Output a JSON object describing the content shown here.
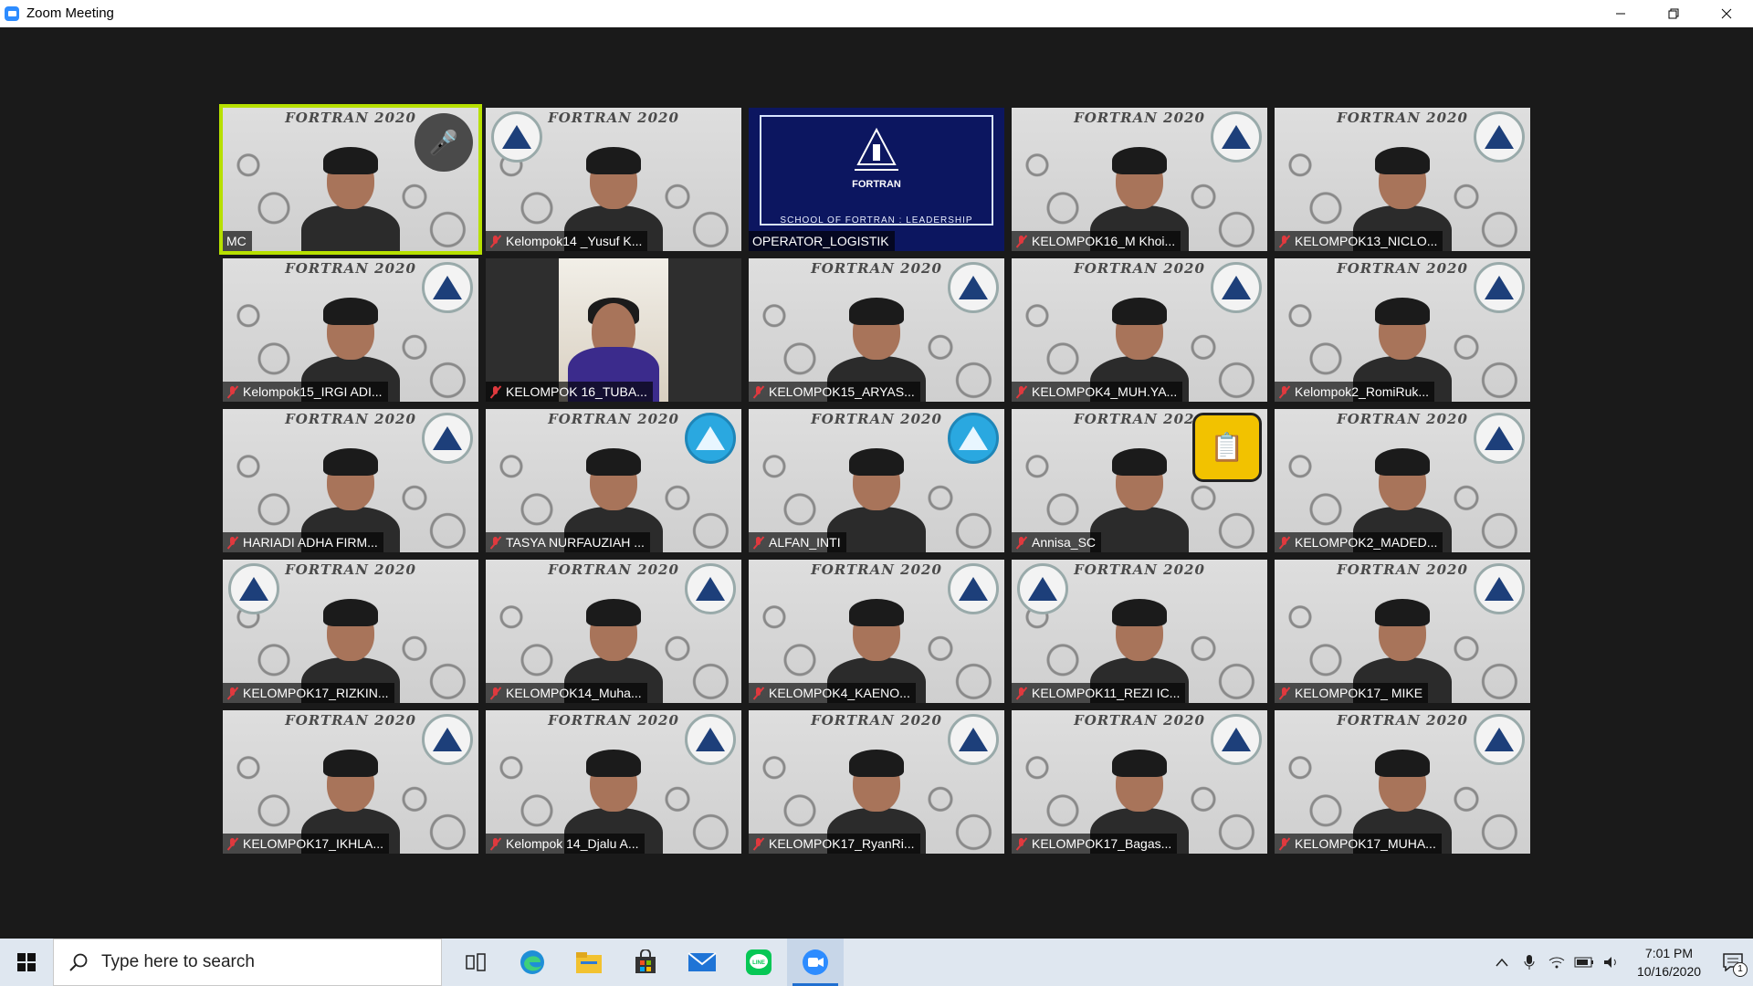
{
  "window": {
    "title": "Zoom Meeting"
  },
  "meeting": {
    "active_speaker": "MC",
    "tile_banner": "FORTRAN 2020",
    "operator_brand": "FORTRAN",
    "operator_tagline": "SCHOOL OF FORTRAN : LEADERSHIP",
    "participants": [
      {
        "name": "MC",
        "muted": false,
        "active": true,
        "badge": "mic-icon"
      },
      {
        "name": "Kelompok14 _Yusuf K...",
        "muted": true
      },
      {
        "name": "OPERATOR_LOGISTIK",
        "muted": false,
        "type": "slide"
      },
      {
        "name": "KELOMPOK16_M Khoi...",
        "muted": true
      },
      {
        "name": "KELOMPOK13_NICLO...",
        "muted": true
      },
      {
        "name": "Kelompok15_IRGI ADI...",
        "muted": true
      },
      {
        "name": "KELOMPOK 16_TUBA...",
        "muted": true,
        "type": "selfie"
      },
      {
        "name": "KELOMPOK15_ARYAS...",
        "muted": true
      },
      {
        "name": "KELOMPOK4_MUH.YA...",
        "muted": true
      },
      {
        "name": "Kelompok2_RomiRuk...",
        "muted": true
      },
      {
        "name": "HARIADI ADHA FIRM...",
        "muted": true
      },
      {
        "name": "TASYA NURFAUZIAH ...",
        "muted": true
      },
      {
        "name": "ALFAN_INTI",
        "muted": true
      },
      {
        "name": "Annisa_SC",
        "muted": true,
        "badge": "clipboard-icon"
      },
      {
        "name": "KELOMPOK2_MADED...",
        "muted": true
      },
      {
        "name": "KELOMPOK17_RIZKIN...",
        "muted": true
      },
      {
        "name": "KELOMPOK14_Muha...",
        "muted": true
      },
      {
        "name": "KELOMPOK4_KAENO...",
        "muted": true
      },
      {
        "name": "KELOMPOK11_REZI IC...",
        "muted": true
      },
      {
        "name": "KELOMPOK17_ MIKE",
        "muted": true
      },
      {
        "name": "KELOMPOK17_IKHLA...",
        "muted": true
      },
      {
        "name": "Kelompok 14_Djalu A...",
        "muted": true
      },
      {
        "name": "KELOMPOK17_RyanRi...",
        "muted": true
      },
      {
        "name": "KELOMPOK17_Bagas...",
        "muted": true
      },
      {
        "name": "KELOMPOK17_MUHA...",
        "muted": true
      }
    ]
  },
  "taskbar": {
    "search_placeholder": "Type here to search",
    "pinned": [
      "task-view-icon",
      "edge-icon",
      "file-explorer-icon",
      "store-icon",
      "mail-icon",
      "line-icon",
      "zoom-icon"
    ],
    "time": "7:01 PM",
    "date": "10/16/2020",
    "notification_count": "1"
  },
  "colors": {
    "active_speaker_border": "#b7e000",
    "muted_icon": "#e0393e",
    "zoom_blue": "#2d8cff"
  }
}
